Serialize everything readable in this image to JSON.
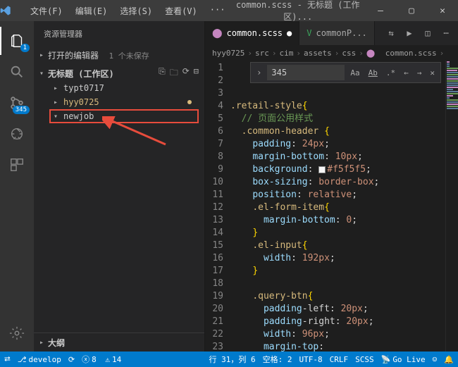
{
  "titlebar": {
    "menu": [
      "文件(F)",
      "编辑(E)",
      "选择(S)",
      "查看(V)",
      "···"
    ],
    "title": "common.scss - 无标题 (工作区)..."
  },
  "activity": {
    "search_badge": "345"
  },
  "sidebar": {
    "header": "资源管理器",
    "openEditors": {
      "label": "打开的编辑器",
      "note": "1 个未保存"
    },
    "workspace": {
      "label": "无标题 (工作区)"
    },
    "tree": [
      {
        "name": "typt0717",
        "kind": "folder"
      },
      {
        "name": "hyy0725",
        "kind": "folder",
        "modified": true
      },
      {
        "name": "newjob",
        "kind": "folder",
        "open": true,
        "hl": true
      }
    ],
    "outline": "大纲"
  },
  "tabs": {
    "items": [
      {
        "label": "common.scss",
        "active": true,
        "dirty": true,
        "icon": "sass"
      },
      {
        "label": "commonP...",
        "active": false,
        "icon": "vue"
      }
    ]
  },
  "breadcrumb": [
    "hyy0725",
    "src",
    "cim",
    "assets",
    "css",
    "common.scss"
  ],
  "find": {
    "value": "345"
  },
  "code": {
    "start": 1,
    "lines": [
      "",
      "",
      "",
      ".retail-style{",
      "  // 页面公用样式",
      "  .common-header {",
      "    padding: 24px;",
      "    margin-bottom: 10px;",
      "    background: #f5f5f5;",
      "    box-sizing: border-box;",
      "    position: relative;",
      "    .el-form-item{",
      "      margin-bottom:0;",
      "    }",
      "    .el-input{",
      "      width: 192px;",
      "    }",
      "",
      "    .query-btn{",
      "      padding-left: 20px;",
      "      padding-right: 20px;",
      "      width: 96px;",
      "      margin-top:"
    ]
  },
  "status": {
    "branch": "develop",
    "sync": "",
    "errors": "8",
    "warnings": "14",
    "pos": "行 31，列 6",
    "spaces": "空格: 2",
    "enc": "UTF-8",
    "eol": "CRLF",
    "lang": "SCSS",
    "golive": "Go Live"
  }
}
